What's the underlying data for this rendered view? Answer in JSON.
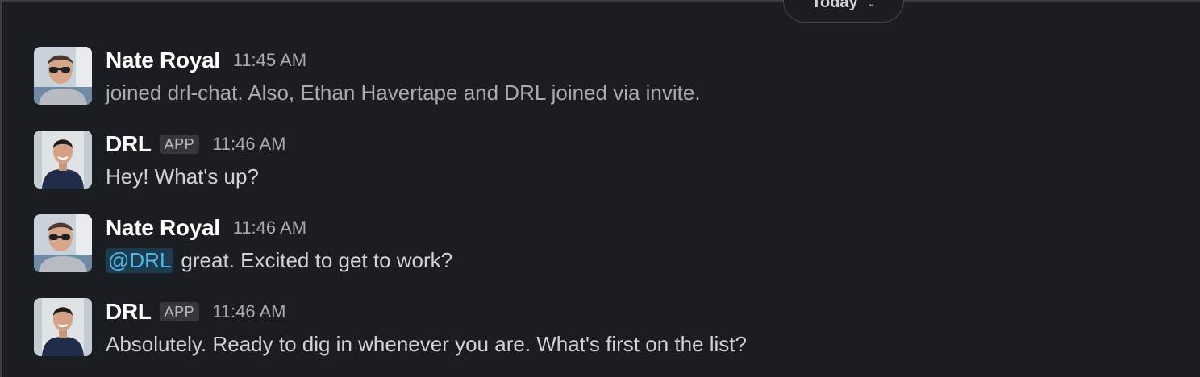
{
  "date_divider": {
    "label": "Today",
    "chevron_icon": "chevron-down-icon"
  },
  "colors": {
    "background": "#1a1d21",
    "mention_bg": "#1d3b4f",
    "mention_text": "#4fb7e8",
    "badge_bg": "#35373b"
  },
  "messages": [
    {
      "sender": "Nate Royal",
      "time": "11:45 AM",
      "text": "joined drl-chat. Also, Ethan Havertape and DRL joined via invite."
    },
    {
      "sender": "DRL",
      "badge": "APP",
      "time": "11:46 AM",
      "text": "Hey! What's up?"
    },
    {
      "sender": "Nate Royal",
      "time": "11:46 AM",
      "mention": "@DRL",
      "text": "great. Excited to get to work?"
    },
    {
      "sender": "DRL",
      "badge": "APP",
      "time": "11:46 AM",
      "text": "Absolutely. Ready to dig in whenever you are. What's first on the list?"
    }
  ]
}
